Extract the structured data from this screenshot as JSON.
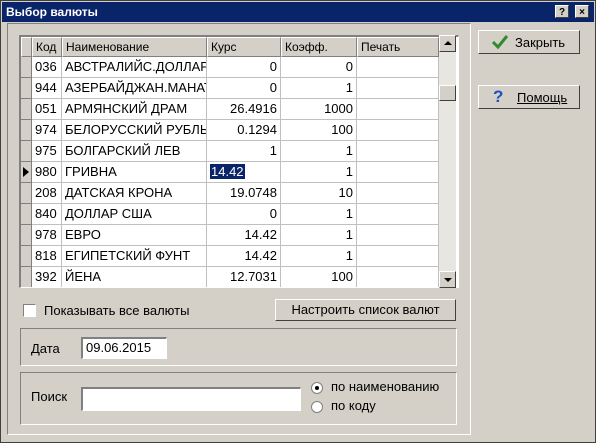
{
  "window": {
    "title": "Выбор валюты",
    "help_glyph": "?",
    "close_glyph": "×"
  },
  "grid": {
    "columns": [
      "Код",
      "Наименование",
      "Курс",
      "Коэфф.",
      "Печать"
    ],
    "rows": [
      {
        "code": "036",
        "name": "АВСТРАЛИЙС.ДОЛЛАР",
        "rate": "0",
        "coef": "0",
        "print": ""
      },
      {
        "code": "944",
        "name": "АЗЕРБАЙДЖАН.МАНАТ",
        "rate": "0",
        "coef": "1",
        "print": ""
      },
      {
        "code": "051",
        "name": "АРМЯНСКИЙ ДРАМ",
        "rate": "26.4916",
        "coef": "1000",
        "print": ""
      },
      {
        "code": "974",
        "name": "БЕЛОРУССКИЙ РУБЛЬ",
        "rate": "0.1294",
        "coef": "100",
        "print": ""
      },
      {
        "code": "975",
        "name": "БОЛГАРСКИЙ ЛЕВ",
        "rate": "1",
        "coef": "1",
        "print": ""
      },
      {
        "code": "980",
        "name": "ГРИВНА",
        "rate": "14.42",
        "coef": "1",
        "print": ""
      },
      {
        "code": "208",
        "name": "ДАТСКАЯ КРОНА",
        "rate": "19.0748",
        "coef": "10",
        "print": ""
      },
      {
        "code": "840",
        "name": "ДОЛЛАР США",
        "rate": "0",
        "coef": "1",
        "print": ""
      },
      {
        "code": "978",
        "name": "ЕВРО",
        "rate": "14.42",
        "coef": "1",
        "print": ""
      },
      {
        "code": "818",
        "name": "ЕГИПЕТСКИЙ ФУНТ",
        "rate": "14.42",
        "coef": "1",
        "print": ""
      },
      {
        "code": "392",
        "name": "ЙЕНА",
        "rate": "12.7031",
        "coef": "100",
        "print": ""
      }
    ],
    "selected_row": 5
  },
  "options": {
    "show_all_label": "Показывать все валюты",
    "show_all_checked": false,
    "configure_label": "Настроить список валют"
  },
  "date": {
    "label": "Дата",
    "value": "09.06.2015"
  },
  "search": {
    "label": "Поиск",
    "value": "",
    "by_name_label": "по наименованию",
    "by_code_label": "по коду",
    "selected": "by_name"
  },
  "buttons": {
    "close_label": "Закрыть",
    "help_label": "Помощь"
  },
  "colors": {
    "title_bar": "#0a246a",
    "face": "#d4d0c8",
    "check_icon": "#2e8b2e",
    "help_icon": "#1f4fbf"
  }
}
